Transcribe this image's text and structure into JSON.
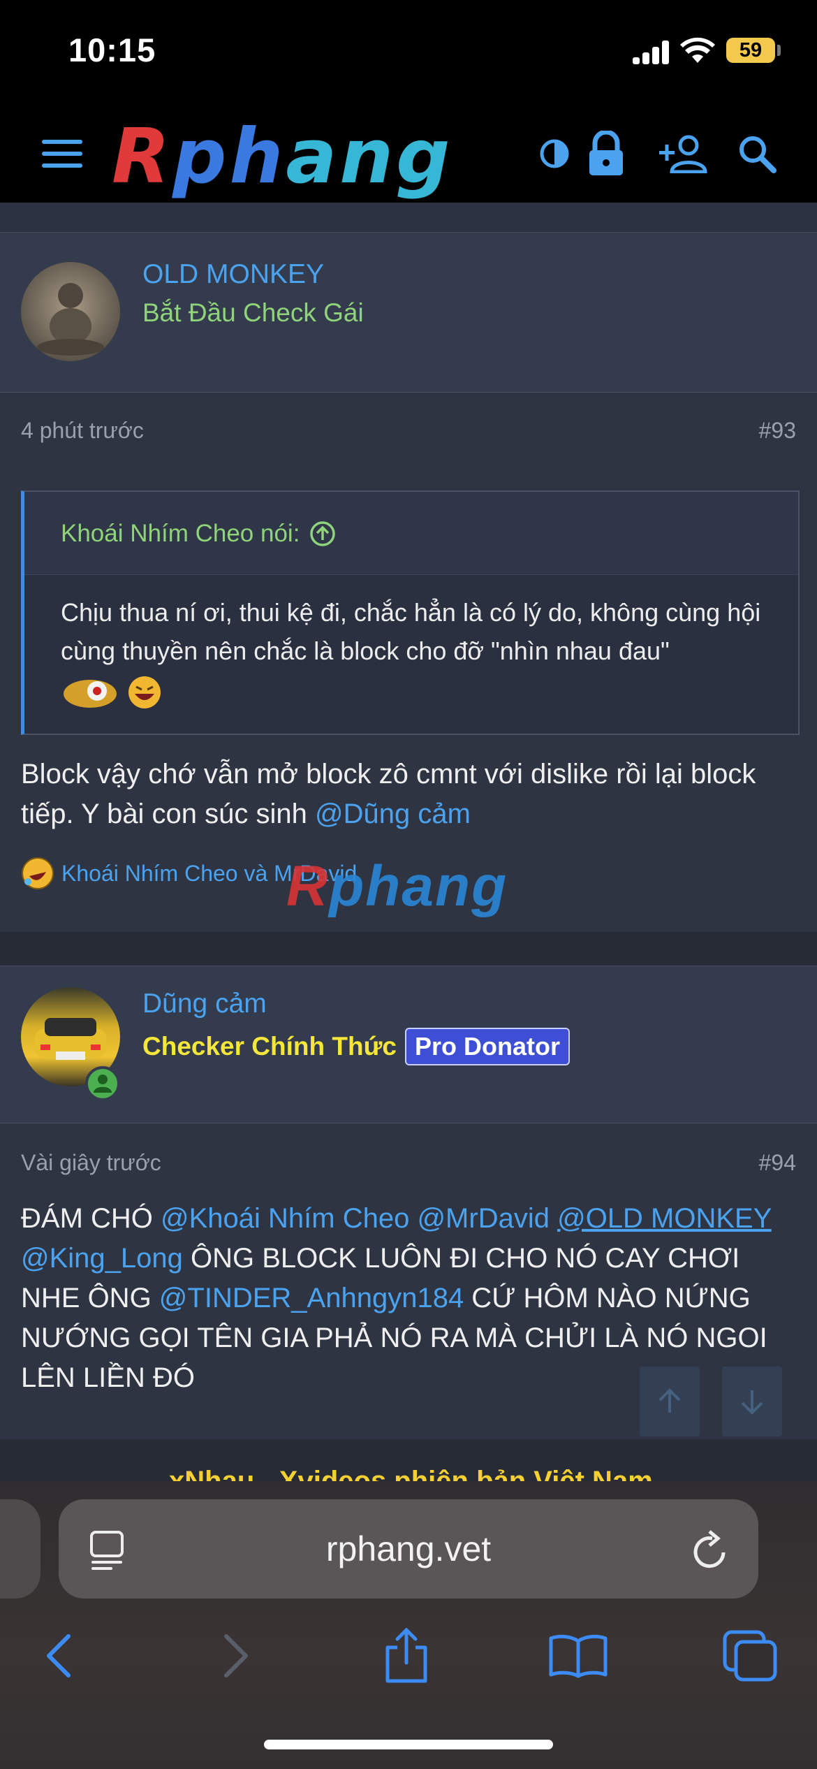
{
  "status": {
    "time": "10:15",
    "battery": "59"
  },
  "site": {
    "logo": "Rphang"
  },
  "post93": {
    "author": "OLD MONKEY",
    "author_title": "Bắt Đầu Check Gái",
    "time": "4 phút trước",
    "number": "#93",
    "quote_author": "Khoái Nhím Cheo nói:",
    "quote_text": "Chịu thua ní ơi, thui kệ đi, chắc hẳn là có lý do, không cùng hội cùng thuyền nên chắc là block cho đỡ \"nhìn nhau đau\"",
    "text": "Block vậy chớ vẫn mở block zô cmnt với dislike rồi lại block tiếp. Y bài con súc sinh ",
    "mention": "@Dũng cảm",
    "reactions": "Khoái Nhím Cheo và MrDavid"
  },
  "post94": {
    "author": "Dũng cảm",
    "author_title": "Checker Chính Thức",
    "badge": "Pro Donator",
    "time": "Vài giây trước",
    "number": "#94",
    "text_1": "ĐÁM CHÓ ",
    "mention_1": "@Khoái Nhím Cheo",
    "mention_2": "@MrDavid",
    "mention_3": "@OLD MONKEY",
    "mention_4": "@King_Long",
    "text_2": " ÔNG BLOCK LUÔN ĐI CHO NÓ CAY CHƠI NHE ÔNG ",
    "mention_5": "@TINDER_Anhngyn184",
    "text_3": " CỨ HÔM NÀO NỨNG NƯỚNG GỌI TÊN GIA PHẢ NÓ RA MÀ CHỬI LÀ NÓ NGOI LÊN LIỀN ĐÓ"
  },
  "promo": "xNhau - Xvideos phiên bản Việt Nam",
  "browser": {
    "url": "rphang.vet"
  },
  "colors": {
    "link": "#4ba3f0",
    "title_green": "#8fd37a",
    "title_yellow": "#f5e63a",
    "badge_bg": "#3e4fd6"
  }
}
